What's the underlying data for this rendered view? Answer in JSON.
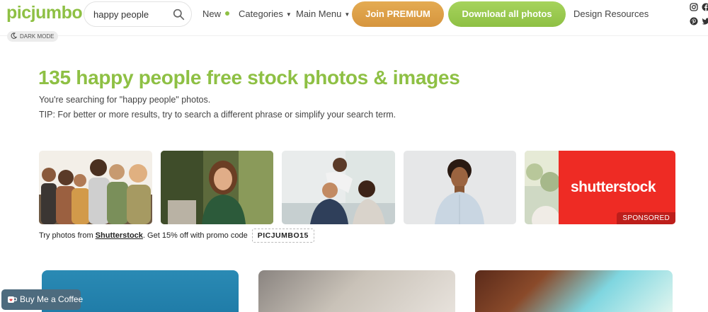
{
  "header": {
    "logo": "picjumbo",
    "search": {
      "value": "happy people"
    },
    "nav": {
      "new": "New",
      "categories": "Categories",
      "main_menu": "Main Menu",
      "design_resources": "Design Resources"
    },
    "buttons": {
      "premium": "Join PREMIUM",
      "download": "Download all photos"
    },
    "dark_mode": "DARK MODE"
  },
  "main": {
    "title": "135 happy people free stock photos & images",
    "subtitle": "You're searching for \"happy people\" photos.",
    "tip": "TIP: For better or more results, try to search a different phrase or simplify your search term."
  },
  "sponsor": {
    "logo": "shutterstock",
    "tag": "SPONSORED",
    "promo_prefix": "Try photos from ",
    "promo_link": "Shutterstock",
    "promo_mid": ". Get 15% off with promo code",
    "promo_code": "PICJUMBO15"
  },
  "widget": {
    "coffee": "Buy Me a Coffee"
  },
  "colors": {
    "brand_green": "#8ec044",
    "premium_orange": "#d99a43",
    "shutterstock_red": "#ee2b24",
    "coffee_widget": "#4d6b7e"
  }
}
